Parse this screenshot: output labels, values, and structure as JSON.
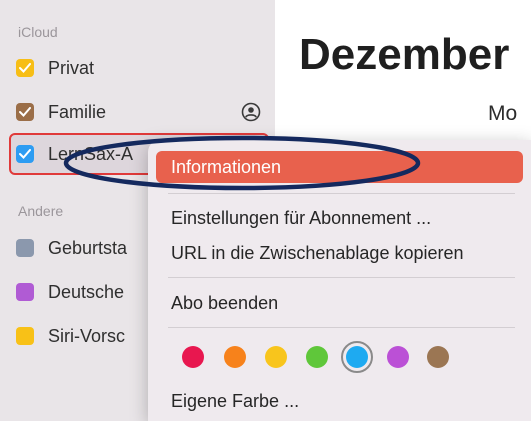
{
  "sidebar": {
    "icloud_label": "iCloud",
    "andere_label": "Andere",
    "icloud_items": [
      {
        "label": "Privat",
        "color": "#f7be16",
        "checked": true
      },
      {
        "label": "Familie",
        "color": "#9b6e48",
        "checked": true,
        "icon": "person-circle-icon"
      },
      {
        "label": "LernSax-A",
        "color": "#2d9cf2",
        "checked": true
      }
    ],
    "andere_items": [
      {
        "label": "Geburtsta",
        "color": "#8b98ad"
      },
      {
        "label": "Deutsche",
        "color": "#b05bd4"
      },
      {
        "label": "Siri-Vorsc",
        "color": "#f8c117"
      }
    ]
  },
  "main": {
    "month_title": "Dezember",
    "weekday": "Mo"
  },
  "context_menu": {
    "items": [
      {
        "label": "Informationen"
      },
      {
        "label": "Einstellungen für Abonnement ..."
      },
      {
        "label": "URL in die Zwischenablage kopieren"
      },
      {
        "label": "Abo beenden"
      },
      {
        "label": "Eigene Farbe ..."
      }
    ],
    "highlight_color": "#e8614d",
    "colors": [
      {
        "name": "red",
        "hex": "#e8174f"
      },
      {
        "name": "orange",
        "hex": "#f7821b"
      },
      {
        "name": "yellow",
        "hex": "#f8c51c"
      },
      {
        "name": "green",
        "hex": "#5fc73a"
      },
      {
        "name": "blue",
        "hex": "#1eaaf1",
        "selected": true
      },
      {
        "name": "purple",
        "hex": "#bb50d6"
      },
      {
        "name": "brown",
        "hex": "#9b7653"
      }
    ]
  }
}
